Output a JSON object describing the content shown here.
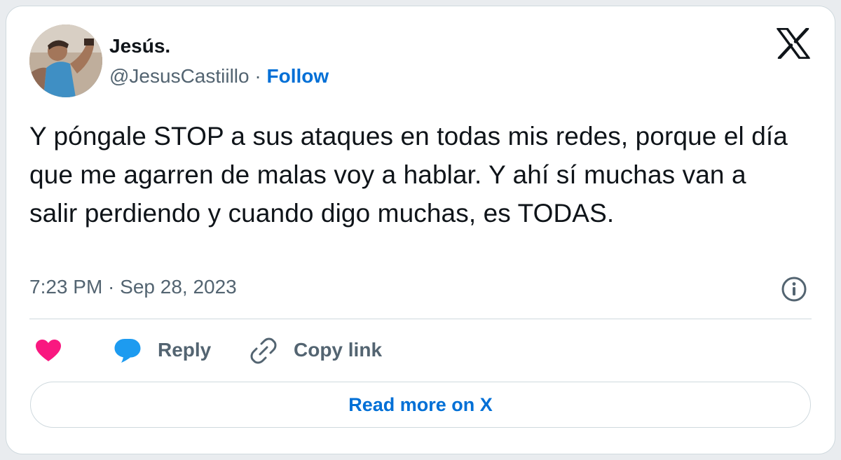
{
  "author": {
    "name": "Jesús.",
    "handle": "@JesusCastiillo",
    "separator": "·",
    "follow_label": "Follow"
  },
  "tweet": {
    "text": "Y póngale STOP a sus ataques en todas mis redes, porque el día que me agarren de malas voy a hablar. Y ahí sí muchas van a salir perdiendo y cuando digo muchas, es TODAS.",
    "timestamp": "7:23 PM · Sep 28, 2023"
  },
  "actions": {
    "reply_label": "Reply",
    "copy_link_label": "Copy link"
  },
  "read_more_label": "Read more on X",
  "icons": {
    "brand": "x-logo-icon",
    "info": "info-icon",
    "like": "heart-icon",
    "reply": "reply-bubble-icon",
    "copy": "link-icon"
  },
  "colors": {
    "link_blue": "#006fd6",
    "like_pink": "#f91880",
    "reply_blue": "#1d9bf0",
    "secondary_text": "#536471",
    "border": "#cfd9de"
  }
}
